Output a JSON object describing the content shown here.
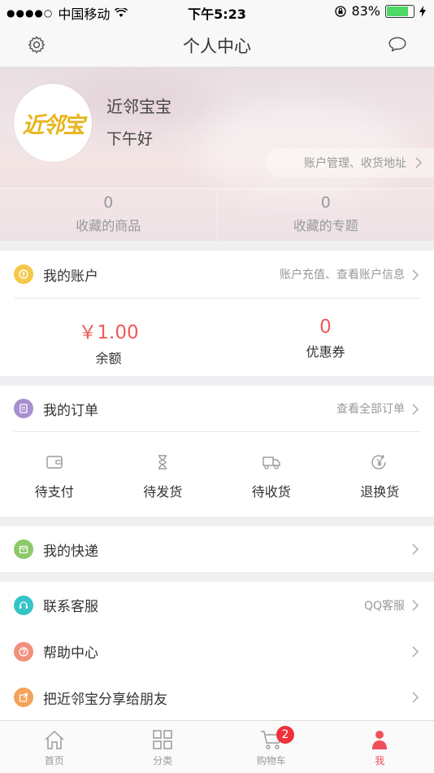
{
  "status_bar": {
    "carrier": "中国移动",
    "time": "下午5:23",
    "battery": "83%",
    "battery_level": 0.83
  },
  "navbar": {
    "title": "个人中心",
    "left_icon": "settings-gear-icon",
    "right_icon": "message-bubble-icon"
  },
  "profile": {
    "name": "近邻宝宝",
    "greeting": "下午好",
    "logo_text": "近邻宝",
    "account_link": "账户管理、收货地址",
    "stats": [
      {
        "value": "0",
        "label": "收藏的商品"
      },
      {
        "value": "0",
        "label": "收藏的专题"
      }
    ]
  },
  "account": {
    "title": "我的账户",
    "right_text": "账户充值、查看账户信息",
    "icon_color": "#f5c84a",
    "balance_value": "￥1.00",
    "balance_label": "余额",
    "coupon_value": "0",
    "coupon_label": "优惠券"
  },
  "orders": {
    "title": "我的订单",
    "right_text": "查看全部订单",
    "icon_color": "#a98fd0",
    "items": [
      {
        "label": "待支付",
        "icon": "wallet-icon"
      },
      {
        "label": "待发货",
        "icon": "hourglass-icon"
      },
      {
        "label": "待收货",
        "icon": "truck-icon"
      },
      {
        "label": "退换货",
        "icon": "yen-return-icon"
      }
    ]
  },
  "express": {
    "title": "我的快递",
    "icon_color": "#8dc96b"
  },
  "services": [
    {
      "title": "联系客服",
      "right_text": "QQ客服",
      "icon_color": "#36c4c8",
      "icon": "headset-icon"
    },
    {
      "title": "帮助中心",
      "right_text": "",
      "icon_color": "#f28f7c",
      "icon": "question-icon"
    },
    {
      "title": "把近邻宝分享给朋友",
      "right_text": "",
      "icon_color": "#f5a25a",
      "icon": "share-icon"
    }
  ],
  "tabbar": {
    "items": [
      {
        "label": "首页",
        "icon": "home-icon"
      },
      {
        "label": "分类",
        "icon": "grid-icon"
      },
      {
        "label": "购物车",
        "icon": "cart-icon",
        "badge": "2"
      },
      {
        "label": "我",
        "icon": "person-icon"
      }
    ],
    "active_color": "#f0505a"
  }
}
